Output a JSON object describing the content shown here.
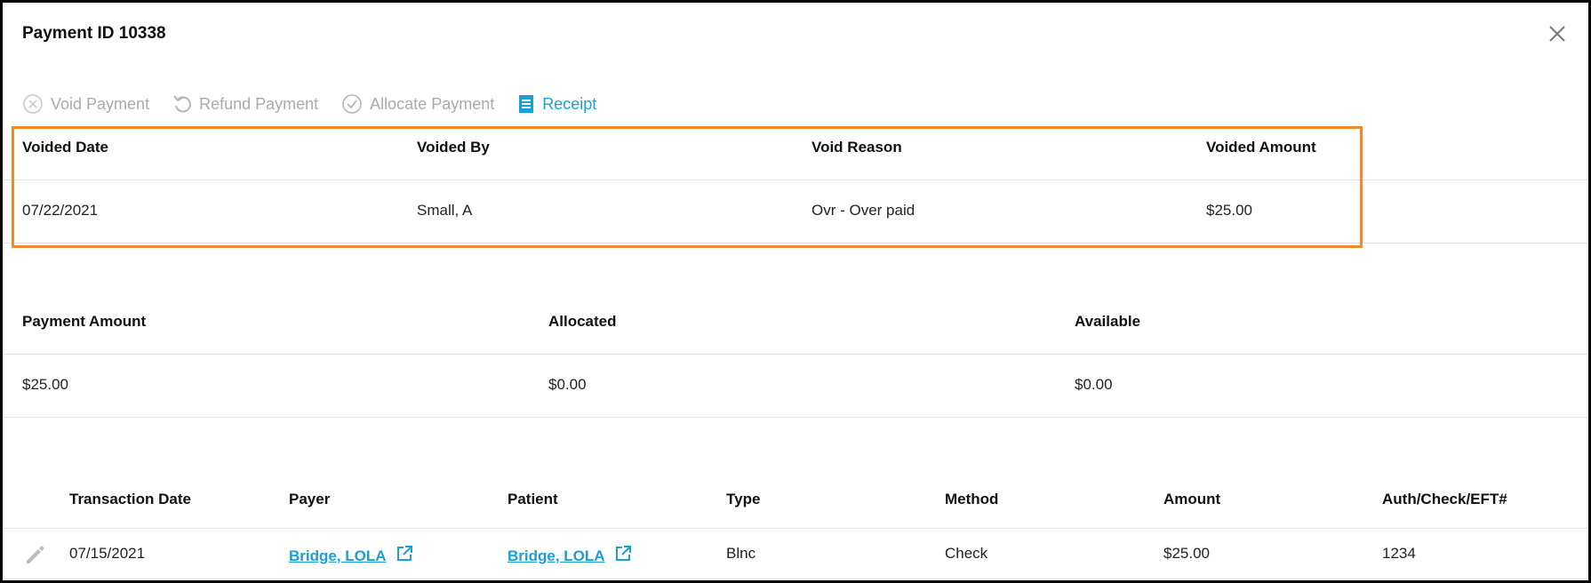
{
  "dialog": {
    "title": "Payment ID 10338"
  },
  "toolbar": {
    "void_label": "Void Payment",
    "refund_label": "Refund Payment",
    "allocate_label": "Allocate Payment",
    "receipt_label": "Receipt"
  },
  "void_info": {
    "headers": [
      "Voided Date",
      "Voided By",
      "Void Reason",
      "Voided Amount"
    ],
    "values": [
      "07/22/2021",
      "Small, A",
      "Ovr - Over paid",
      "$25.00"
    ]
  },
  "summary": {
    "headers": [
      "Payment Amount",
      "Allocated",
      "Available"
    ],
    "values": [
      "$25.00",
      "$0.00",
      "$0.00"
    ]
  },
  "transactions": {
    "headers": [
      "Transaction Date",
      "Payer",
      "Patient",
      "Type",
      "Method",
      "Amount",
      "Auth/Check/EFT#"
    ],
    "rows": [
      {
        "date": "07/15/2021",
        "payer": "Bridge, LOLA",
        "patient": "Bridge, LOLA",
        "type": "Blnc",
        "method": "Check",
        "amount": "$25.00",
        "auth": "1234"
      }
    ]
  },
  "colors": {
    "accent": "#1a9fd8",
    "highlight": "#f08a2c",
    "disabled": "#aaaaaa"
  }
}
